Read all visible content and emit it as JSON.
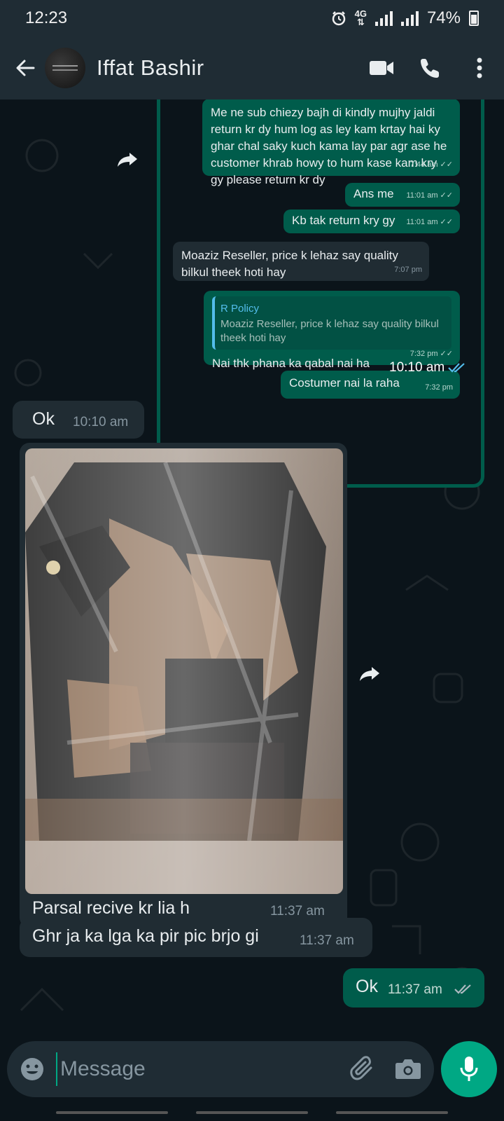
{
  "status": {
    "time": "12:23",
    "network": "4G",
    "battery": "74%"
  },
  "header": {
    "contact_name": "Iffat Bashir"
  },
  "screenshot": {
    "messages": [
      {
        "dir": "out",
        "text": "Me ne sub chiezy bajh di kindly mujhy jaldi return kr dy  hum log as ley kam krtay hai ky ghar chal saky kuch kama lay par agr ase he customer khrab howy to hum kase kam kry gy please return kr dy",
        "time": "7:44 am"
      },
      {
        "dir": "out",
        "text": "Ans me",
        "time": "11:01 am"
      },
      {
        "dir": "out",
        "text": "Kb tak return kry gy",
        "time": "11:01 am"
      },
      {
        "dir": "in",
        "text": "Moaziz Reseller, price k lehaz say quality bilkul theek hoti hay",
        "time": "7:07 pm"
      },
      {
        "dir": "out",
        "quote_name": "R Policy",
        "quote_text": "Moaziz Reseller, price k lehaz say quality bilkul theek hoti hay",
        "text": "Nai thk phana ka qabal nai ha",
        "time": "7:32 pm"
      },
      {
        "dir": "out",
        "text": "Costumer nai la raha",
        "time": "7:32 pm"
      }
    ],
    "sent_time": "10:10 am"
  },
  "messages": [
    {
      "dir": "in",
      "text": "Ok",
      "time": "10:10 am"
    },
    {
      "dir": "in",
      "caption": "Parsal recive kr lia h",
      "time": "11:37 am"
    },
    {
      "dir": "in",
      "text": "Ghr ja ka lga ka pir pic brjo gi",
      "time": "11:37 am"
    },
    {
      "dir": "out",
      "text": "Ok",
      "time": "11:37 am"
    }
  ],
  "input": {
    "placeholder": "Message"
  },
  "colors": {
    "outgoing": "#005c4b",
    "incoming": "#202c33",
    "accent": "#00a884",
    "read_tick": "#53bdeb"
  }
}
